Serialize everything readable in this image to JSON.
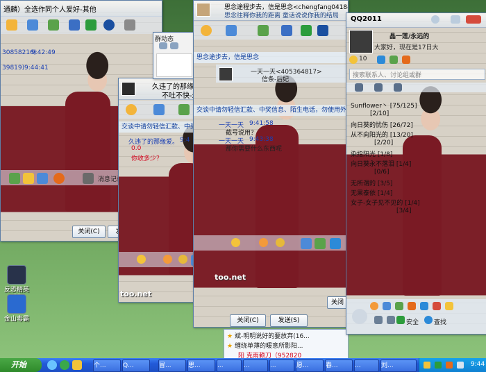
{
  "desktop": {
    "icons": [
      {
        "label": "反恐精英",
        "sub": "CS"
      },
      {
        "label": "金山毒霸"
      }
    ]
  },
  "win_left": {
    "title": "通麟）全选作同个人爱好-其他",
    "lines": [
      "30858216)",
      "9:42:49",
      "39819)",
      "9:44:41"
    ],
    "sidebar_label": "消息记录",
    "close_label": "关闭(C)",
    "send_label": "发"
  },
  "win_mid": {
    "title": "久违了的那缘爱",
    "subtitle": "不吐不快-永远",
    "notice": "交谈中请勿轻信汇款、中奖信息、陌生电话，勿使用外挂软件。",
    "msg1_name": "久违了的那缘爱。",
    "msg1_time": "9:4",
    "msg1_text1": "0.0",
    "msg1_text2": "你收多少？",
    "tab_label": "群动态",
    "watermark": "too.net"
  },
  "win_center": {
    "title": "思念途程步去，信是思念<chengfang0418@qq.com>",
    "subtitle": "思念往释你我的距离 童话说说你我的结局",
    "notice1": "思念途步去，信是思念",
    "notice2": "交谈中请勿轻信汇款、中奖信息、陌生电话，勿使用外挂软件。",
    "chat_title": "一天一天<405364817>",
    "chat_sub": "信条-后妃",
    "messages": [
      {
        "name": "一天一天",
        "time": "9:41:58",
        "text": "截号说用？"
      },
      {
        "name": "一天一天",
        "time": "9:43:38",
        "text": "那你需要什么东西呢"
      }
    ],
    "close_label": "关闭(C)",
    "send_label": "发送(S)",
    "close2_label": "关闭",
    "watermark": "too.net",
    "group_items": [
      "斌-明明说好的要放弃(16...",
      "缠绕单薄的暖意所影阳..."
    ],
    "group_item3": "阳 克雨赖刀（952820"
  },
  "main_panel": {
    "title": "QQ2011",
    "nickname": "晶一莲/永远的",
    "signature": "大家好，现在是17日大",
    "level": "10",
    "search_placeholder": "搜索联系人、讨论组或群",
    "buddies": [
      {
        "name": "Sunflower丶",
        "detail": "[75/125]"
      },
      {
        "name": "",
        "detail": "[2/10]"
      },
      {
        "name": "向日葵的忧伤",
        "detail": "[26/72]"
      },
      {
        "name": "从不向阳光的",
        "detail": "[13/20]"
      },
      {
        "name": "",
        "detail": "[2/20]"
      },
      {
        "name": "染指阳光",
        "detail": "[1/8]"
      },
      {
        "name": "向日葵永不落泪",
        "detail": "[1/4]"
      },
      {
        "name": "",
        "detail": "[0/6]"
      },
      {
        "name": "无所谓的",
        "detail": "[3/5]"
      },
      {
        "name": "无果泰依",
        "detail": "[1/4]"
      },
      {
        "name": "女子-女子见不见的",
        "detail": "[1/4]"
      },
      {
        "name": "",
        "detail": "[3/4]"
      }
    ],
    "bottom": {
      "security_label": "安全",
      "find_label": "查找"
    }
  },
  "taskbar": {
    "start_label": "开始",
    "tasks": [
      "个...",
      "Q...",
      "冒...",
      "思...",
      "...",
      "...",
      "...",
      "愿...",
      "春...",
      "...",
      "刘..."
    ],
    "clock": "9:44"
  },
  "colors": {
    "accent": "#225ad8",
    "start": "#2e8a2a",
    "cardigan": "#7c1f28"
  }
}
